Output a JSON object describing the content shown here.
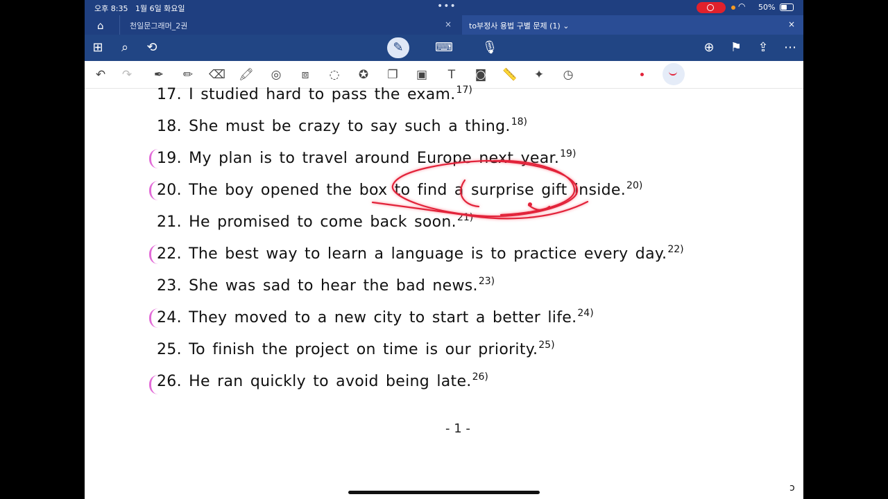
{
  "status": {
    "time": "오후 8:35",
    "date": "1월 6일 화요일",
    "battery": "50%"
  },
  "tabs": [
    {
      "label": "천일문그래머_2권",
      "close": "×"
    },
    {
      "label": "to부정사 용법 구별 문제 (1)",
      "chevron": "⌄",
      "close": "×"
    }
  ],
  "toolbar": {
    "left_icons": [
      "grid-icon",
      "search-icon",
      "lasso-plus-icon"
    ],
    "center_icons": [
      "pen-mode-icon",
      "keyboard-icon",
      "mic-icon"
    ],
    "right_icons": [
      "add-page-icon",
      "bookmark-icon",
      "share-icon",
      "more-icon"
    ]
  },
  "penbar": {
    "tools": [
      "undo-icon",
      "redo-icon",
      "pen-icon",
      "pencil-icon",
      "eraser-icon",
      "highlighter-icon",
      "shape-icon",
      "lasso-fill-icon",
      "lasso-icon",
      "sticker-icon",
      "copy-icon",
      "image-icon",
      "text-icon",
      "camera-icon",
      "ruler-icon",
      "laser-icon",
      "clock-icon"
    ],
    "active_color": "#e2233a"
  },
  "document": {
    "lines": [
      {
        "text": "17. I studied hard to pass the exam.",
        "note": "17)"
      },
      {
        "text": "18. She must be crazy to say such a thing.",
        "note": "18)"
      },
      {
        "text": "19. My plan is to travel around Europe next year.",
        "note": "19)"
      },
      {
        "text": "20. The boy opened the box to find a surprise gift inside.",
        "note": "20)"
      },
      {
        "text": "21. He promised to come back soon.",
        "note": "21)"
      },
      {
        "text": "22. The best way to learn a language is to practice every day.",
        "note": "22)"
      },
      {
        "text": "23. She was sad to hear the bad news.",
        "note": "23)"
      },
      {
        "text": "24. They moved to a new city to start a better life.",
        "note": "24)"
      },
      {
        "text": "25. To finish the project on time is our priority.",
        "note": "25)"
      },
      {
        "text": "26. He ran quickly to avoid being late.",
        "note": "26)"
      }
    ],
    "page_number": "- 1 -"
  }
}
